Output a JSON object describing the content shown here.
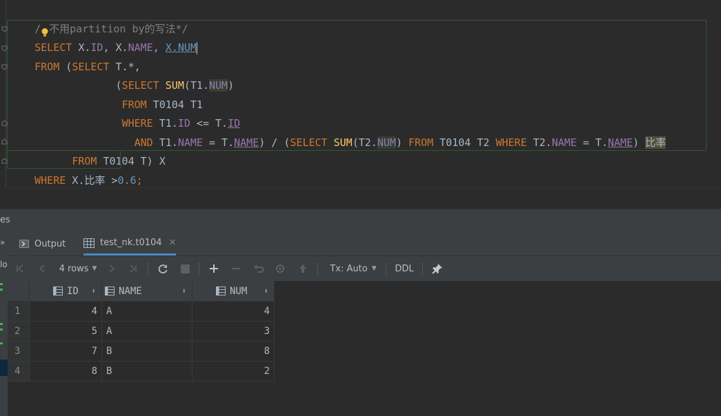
{
  "editor": {
    "comment": "/*不用partition by的写法*/",
    "code_line_1": "SELECT X.ID, X.NAME, X.NUM",
    "code_line_2": "FROM (SELECT T.*,",
    "code_line_3": "(SELECT SUM(T1.NUM)",
    "code_line_4": "FROM T0104 T1",
    "code_line_5": "WHERE T1.ID <= T.ID",
    "code_line_6": "AND T1.NAME = T.NAME) / (SELECT SUM(T2.NUM) FROM T0104 T2 WHERE T2.NAME = T.NAME) 比率",
    "code_line_7": "FROM T0104 T) X",
    "code_line_8": "WHERE X.比率 >0.6;"
  },
  "tool_window": {
    "header_clip": "es",
    "left_clip": "lo",
    "tabs": [
      {
        "label": "Output",
        "icon": "console-icon",
        "active": false
      },
      {
        "label": "test_nk.t0104",
        "icon": "table-icon",
        "active": true
      }
    ]
  },
  "toolbar": {
    "rows_label": "4 rows",
    "tx_label": "Tx: Auto",
    "ddl_label": "DDL"
  },
  "grid": {
    "columns": [
      "ID",
      "NAME",
      "NUM"
    ],
    "rows": [
      {
        "n": "1",
        "id": "4",
        "name": "A",
        "num": "4"
      },
      {
        "n": "2",
        "id": "5",
        "name": "A",
        "num": "3"
      },
      {
        "n": "3",
        "id": "7",
        "name": "B",
        "num": "8"
      },
      {
        "n": "4",
        "id": "8",
        "name": "B",
        "num": "2"
      }
    ]
  },
  "colors": {
    "keyword": "#cc7832",
    "function": "#ffc66d",
    "column": "#9876aa",
    "number": "#6897bb",
    "accent": "#4a88c7"
  }
}
